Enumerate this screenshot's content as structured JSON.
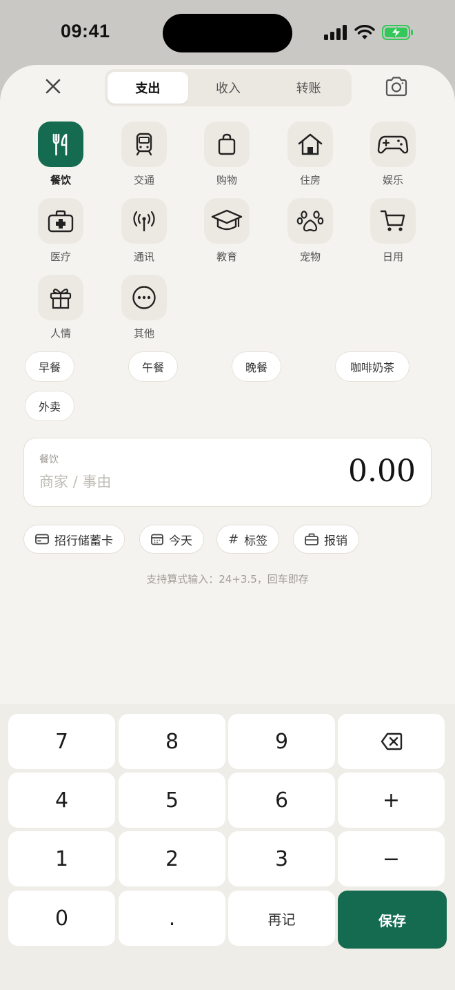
{
  "status_bar": {
    "time": "09:41"
  },
  "tabs": [
    {
      "label": "支出",
      "active": true
    },
    {
      "label": "收入",
      "active": false
    },
    {
      "label": "转账",
      "active": false
    }
  ],
  "categories": [
    {
      "label": "餐饮",
      "icon": "fork-knife-icon",
      "active": true
    },
    {
      "label": "交通",
      "icon": "train-icon",
      "active": false
    },
    {
      "label": "购物",
      "icon": "shopping-bag-icon",
      "active": false
    },
    {
      "label": "住房",
      "icon": "house-icon",
      "active": false
    },
    {
      "label": "娱乐",
      "icon": "gamepad-icon",
      "active": false
    },
    {
      "label": "医疗",
      "icon": "medical-kit-icon",
      "active": false
    },
    {
      "label": "通讯",
      "icon": "antenna-icon",
      "active": false
    },
    {
      "label": "教育",
      "icon": "graduation-cap-icon",
      "active": false
    },
    {
      "label": "宠物",
      "icon": "paw-icon",
      "active": false
    },
    {
      "label": "日用",
      "icon": "cart-icon",
      "active": false
    },
    {
      "label": "人情",
      "icon": "gift-icon",
      "active": false
    },
    {
      "label": "其他",
      "icon": "more-icon",
      "active": false
    }
  ],
  "quick_tags": [
    "早餐",
    "午餐",
    "晚餐",
    "咖啡奶茶",
    "外卖"
  ],
  "entry": {
    "category": "餐饮",
    "merchant_placeholder": "商家 / 事由",
    "amount": "0.00"
  },
  "meta": {
    "account": "招行储蓄卡",
    "date": "今天",
    "tag": "标签",
    "reimburse": "报销"
  },
  "hint": "支持算式输入：24+3.5，回车即存",
  "keypad": {
    "digits": [
      "7",
      "8",
      "9",
      "4",
      "5",
      "6",
      "1",
      "2",
      "3",
      "0",
      "."
    ],
    "plus": "+",
    "minus": "−",
    "again": "再记",
    "save": "保存"
  },
  "colors": {
    "accent": "#146b4f",
    "background": "#f5f3ef",
    "tile": "#ece9e2",
    "battery": "#34c759"
  }
}
